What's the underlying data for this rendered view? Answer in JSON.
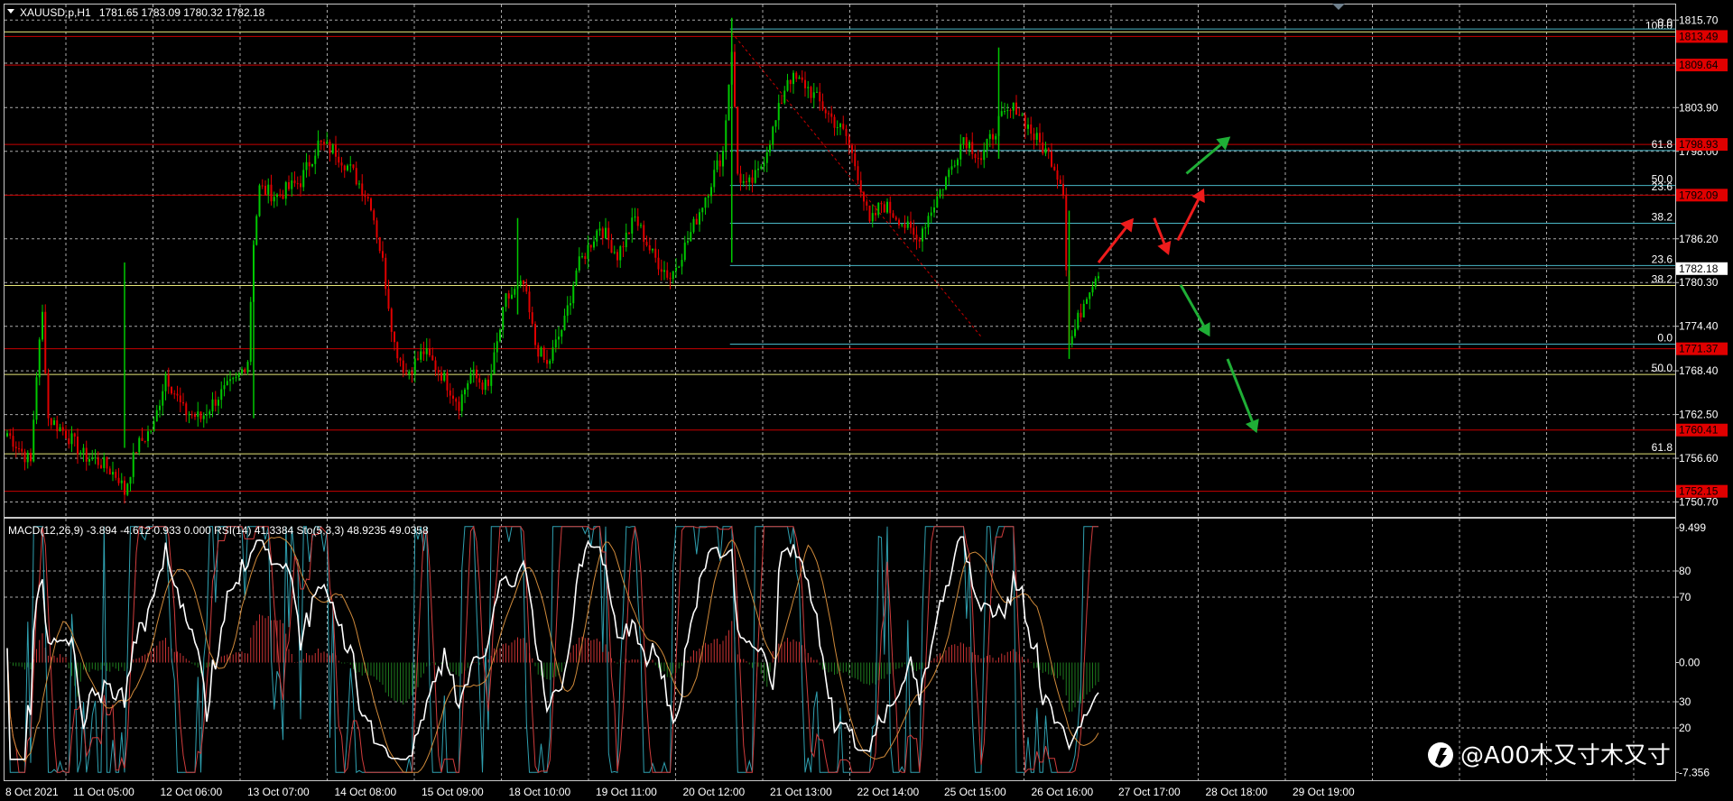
{
  "header": {
    "symbol": "XAUUSD.p,H1",
    "ohlc": "1781.65 1783.09 1780.32 1782.18"
  },
  "indicator_header": {
    "text": "MACD(12,26,9) -3.894 -4.612 0.933 0.000  RSI(14) 41.3384  Sto(5,3,3) 48.9235 49.0358"
  },
  "watermark": {
    "text": "@A00木又寸木又寸"
  },
  "colors": {
    "bull": "#00c800",
    "bear": "#e00000",
    "grid": "#c8c8c8",
    "red_line": "#c80000",
    "yellow_line": "#e6e678",
    "cyan_line": "#4ab8c8",
    "macd_up": "#c83232",
    "macd_down": "#1e7a1e",
    "rsi": "#ffffff"
  },
  "chart_data": [
    {
      "type": "candlestick",
      "title": "XAUUSD.p,H1",
      "ylim": [
        1748.7,
        1817.8
      ],
      "y_ticks": [
        "1815.70",
        "1809.90",
        "1803.90",
        "1798.00",
        "1792.10",
        "1786.20",
        "1780.30",
        "1774.40",
        "1768.40",
        "1762.50",
        "1756.60",
        "1750.70"
      ],
      "x_labels": [
        "8 Oct 2021",
        "11 Oct 05:00",
        "12 Oct 06:00",
        "13 Oct 07:00",
        "14 Oct 08:00",
        "15 Oct 09:00",
        "18 Oct 10:00",
        "19 Oct 11:00",
        "20 Oct 12:00",
        "21 Oct 13:00",
        "22 Oct 14:00",
        "25 Oct 15:00",
        "26 Oct 16:00",
        "27 Oct 17:00",
        "28 Oct 18:00",
        "29 Oct 19:00"
      ],
      "anchors": [
        [
          0,
          1760
        ],
        [
          4,
          1758
        ],
        [
          8,
          1756
        ],
        [
          10,
          1768
        ],
        [
          12,
          1776
        ],
        [
          14,
          1762
        ],
        [
          20,
          1760
        ],
        [
          26,
          1757
        ],
        [
          32,
          1756
        ],
        [
          38,
          1754
        ],
        [
          40,
          1752
        ],
        [
          44,
          1758
        ],
        [
          50,
          1761
        ],
        [
          54,
          1768
        ],
        [
          60,
          1763
        ],
        [
          66,
          1762
        ],
        [
          72,
          1765
        ],
        [
          78,
          1767
        ],
        [
          82,
          1770
        ],
        [
          84,
          1786
        ],
        [
          86,
          1793
        ],
        [
          92,
          1792
        ],
        [
          100,
          1794
        ],
        [
          106,
          1799
        ],
        [
          112,
          1798
        ],
        [
          118,
          1795
        ],
        [
          124,
          1791
        ],
        [
          128,
          1783
        ],
        [
          132,
          1772
        ],
        [
          136,
          1768
        ],
        [
          142,
          1771
        ],
        [
          148,
          1768
        ],
        [
          154,
          1764
        ],
        [
          158,
          1768
        ],
        [
          164,
          1766
        ],
        [
          170,
          1778
        ],
        [
          176,
          1780
        ],
        [
          180,
          1772
        ],
        [
          184,
          1769
        ],
        [
          190,
          1775
        ],
        [
          194,
          1782
        ],
        [
          202,
          1788
        ],
        [
          208,
          1784
        ],
        [
          214,
          1789
        ],
        [
          220,
          1784
        ],
        [
          226,
          1781
        ],
        [
          232,
          1786
        ],
        [
          238,
          1792
        ],
        [
          244,
          1798
        ],
        [
          247,
          1812
        ],
        [
          249,
          1795
        ],
        [
          252,
          1793
        ],
        [
          256,
          1795
        ],
        [
          262,
          1802
        ],
        [
          266,
          1808
        ],
        [
          272,
          1807
        ],
        [
          280,
          1803
        ],
        [
          286,
          1800
        ],
        [
          290,
          1795
        ],
        [
          294,
          1788
        ],
        [
          298,
          1791
        ],
        [
          304,
          1789
        ],
        [
          310,
          1786
        ],
        [
          316,
          1791
        ],
        [
          322,
          1796
        ],
        [
          326,
          1800
        ],
        [
          332,
          1797
        ],
        [
          338,
          1802
        ],
        [
          344,
          1804
        ],
        [
          350,
          1800
        ],
        [
          356,
          1797
        ],
        [
          360,
          1793
        ],
        [
          362,
          1772
        ],
        [
          364,
          1774
        ],
        [
          368,
          1779
        ],
        [
          372,
          1782
        ]
      ],
      "candle_count": 373,
      "candle_step": 3.25,
      "last_price": "1782.18",
      "price_box": {
        "text": "1782.18",
        "value": 1782.18
      },
      "levels": [
        {
          "value": 1813.49,
          "color": "#c80000",
          "label": "1813.49",
          "kind": "price-box-red"
        },
        {
          "value": 1809.64,
          "color": "#c80000",
          "label": "1809.64",
          "kind": "price-box-red"
        },
        {
          "value": 1798.93,
          "color": "#c80000",
          "label": "1798.93",
          "kind": "price-box-red"
        },
        {
          "value": 1792.09,
          "color": "#c80000",
          "label": "1792.09",
          "kind": "price-box-red"
        },
        {
          "value": 1771.37,
          "color": "#c80000",
          "label": "1771.37",
          "kind": "price-box-red"
        },
        {
          "value": 1760.41,
          "color": "#c80000",
          "label": "1760.41",
          "kind": "price-box-red"
        },
        {
          "value": 1752.15,
          "color": "#c80000",
          "label": "1752.15",
          "kind": "price-box-red"
        }
      ],
      "fib_long": {
        "color": "#e6e678",
        "levels": [
          {
            "label": "100.0",
            "value": 1814.1
          },
          {
            "label": "38.2",
            "value": 1779.9
          },
          {
            "label": "50.0",
            "value": 1767.9
          },
          {
            "label": "61.8",
            "value": 1757.2
          }
        ]
      },
      "fib_short": {
        "color": "#4ab8c8",
        "levels": [
          {
            "label": "0.0",
            "value": 1772.0
          },
          {
            "label": "23.6",
            "value": 1782.6
          },
          {
            "label": "38.2",
            "value": 1788.3
          },
          {
            "label": "50.0",
            "value": 1793.4
          },
          {
            "label": "61.8",
            "value": 1798.1
          },
          {
            "label": "0.0",
            "value": 1814.5
          }
        ],
        "extra_labels": [
          {
            "label": "23.6",
            "value": 1792.4,
            "color": "#e6e678"
          }
        ]
      },
      "arrows": [
        {
          "color": "red",
          "from": [
            372,
            1783
          ],
          "to": [
            384,
            1789
          ]
        },
        {
          "color": "red",
          "from": [
            391,
            1789
          ],
          "to": [
            396,
            1784
          ]
        },
        {
          "color": "red",
          "from": [
            399,
            1786
          ],
          "to": [
            408,
            1793
          ]
        },
        {
          "color": "green",
          "from": [
            402,
            1795
          ],
          "to": [
            417,
            1800
          ]
        },
        {
          "color": "green",
          "from": [
            400,
            1780
          ],
          "to": [
            410,
            1773
          ]
        },
        {
          "color": "green",
          "from": [
            416,
            1770
          ],
          "to": [
            426,
            1760
          ]
        }
      ]
    },
    {
      "type": "oscillator",
      "title": "MACD(12,26,9) / RSI(14) / Sto(5,3,3)",
      "ylim": [
        -7.356,
        9.499
      ],
      "y_ticks": [
        "9.499",
        "80",
        "70",
        "0.00",
        "30",
        "20",
        "-7.356"
      ],
      "macd_last": -3.894,
      "rsi_last": 41.3384,
      "sto_last": [
        48.9235,
        49.0358
      ]
    }
  ]
}
